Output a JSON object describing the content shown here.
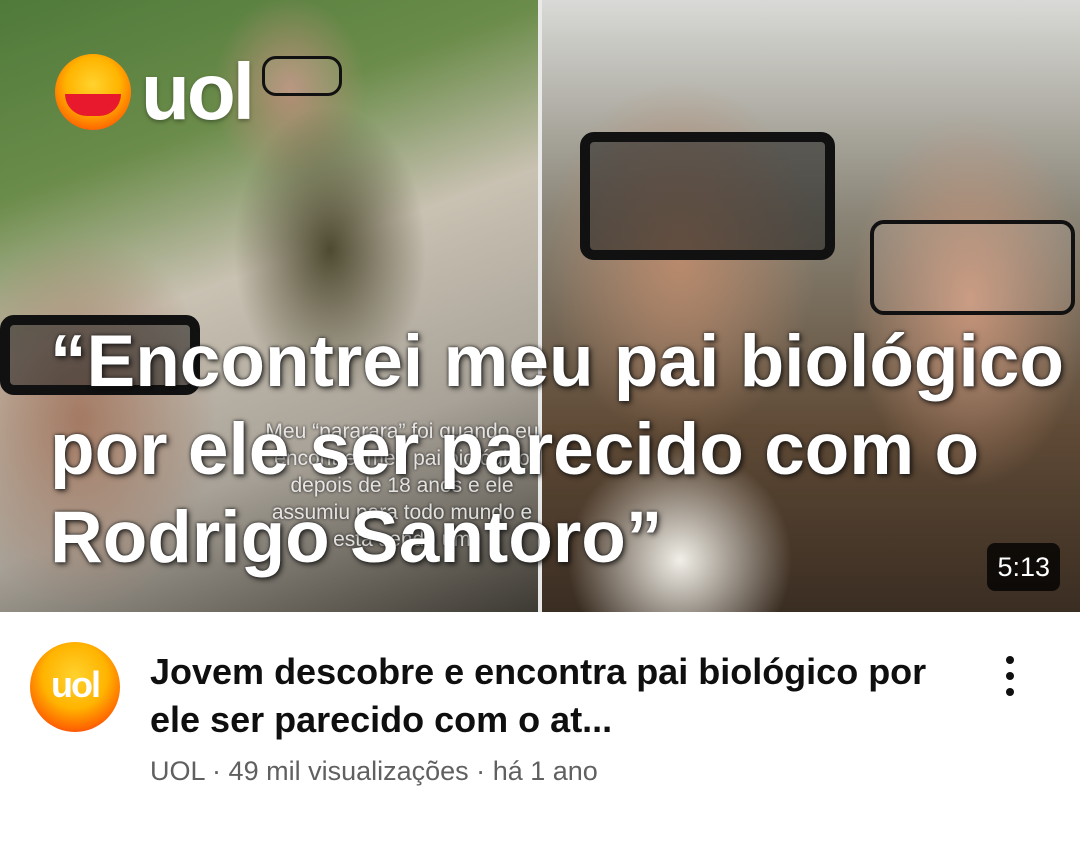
{
  "thumbnail": {
    "logo_text": "uol",
    "headline": "“Encontrei meu pai biológico por ele ser parecido com o Rodrigo Santoro”",
    "overlay_caption": "Meu “pararara” foi quando eu encontrei meu pai biológico depois de 18 anos e ele assumiu para todo mundo e está sendo um",
    "duration": "5:13"
  },
  "video": {
    "title": "Jovem descobre e encontra pai biológico por ele ser parecido com o at...",
    "channel": "UOL",
    "views": "49 mil visualizações",
    "age": "há 1 ano",
    "separator": "·"
  },
  "channel_avatar": {
    "text": "uol"
  },
  "colors": {
    "title": "#0f0f0f",
    "subtitle": "#606060",
    "uol_red": "#e8192c",
    "uol_yellow": "#ffb400"
  },
  "icons": {
    "more": "vertical-ellipsis-icon"
  }
}
